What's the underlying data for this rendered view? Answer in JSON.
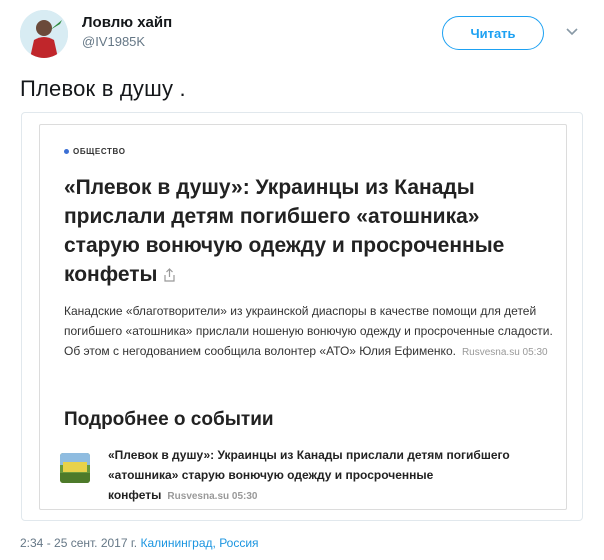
{
  "tweet": {
    "display_name": "Ловлю хайп",
    "handle": "@IV1985K",
    "follow_label": "Читать",
    "text": "Плевок в душу ."
  },
  "article": {
    "category": "ОБЩЕСТВО",
    "headline": "«Плевок в душу»: Украинцы из Канады прислали детям погибшего «атошника» старую вонючую одежду и просроченные конфеты",
    "lede": "Канадские «благотворители» из украинской диаспоры в качестве помощи для детей погибшего «атошника» прислали ношеную вонючую одежду и просроченные сладости. Об этом с негодованием сообщила волонтер «АТО» Юлия Ефименко.",
    "lede_meta": "Rusvesna.su 05:30",
    "more_heading": "Подробнее о событии",
    "related": {
      "title": "«Плевок в душу»: Украинцы из Канады прислали детям погибшего «атошника» старую вонючую одежду и просроченные конфеты",
      "meta": "Rusvesna.su 05:30"
    }
  },
  "footer": {
    "time": "2:34 - 25 сент. 2017 г.",
    "location": "Калининград, Россия"
  },
  "colors": {
    "accent": "#1da1f2",
    "secondary_text": "#657786",
    "category_dot": "#3b6fd4"
  },
  "icons": [
    "avatar",
    "chevron-down-icon",
    "share-icon",
    "related-thumbnail"
  ]
}
